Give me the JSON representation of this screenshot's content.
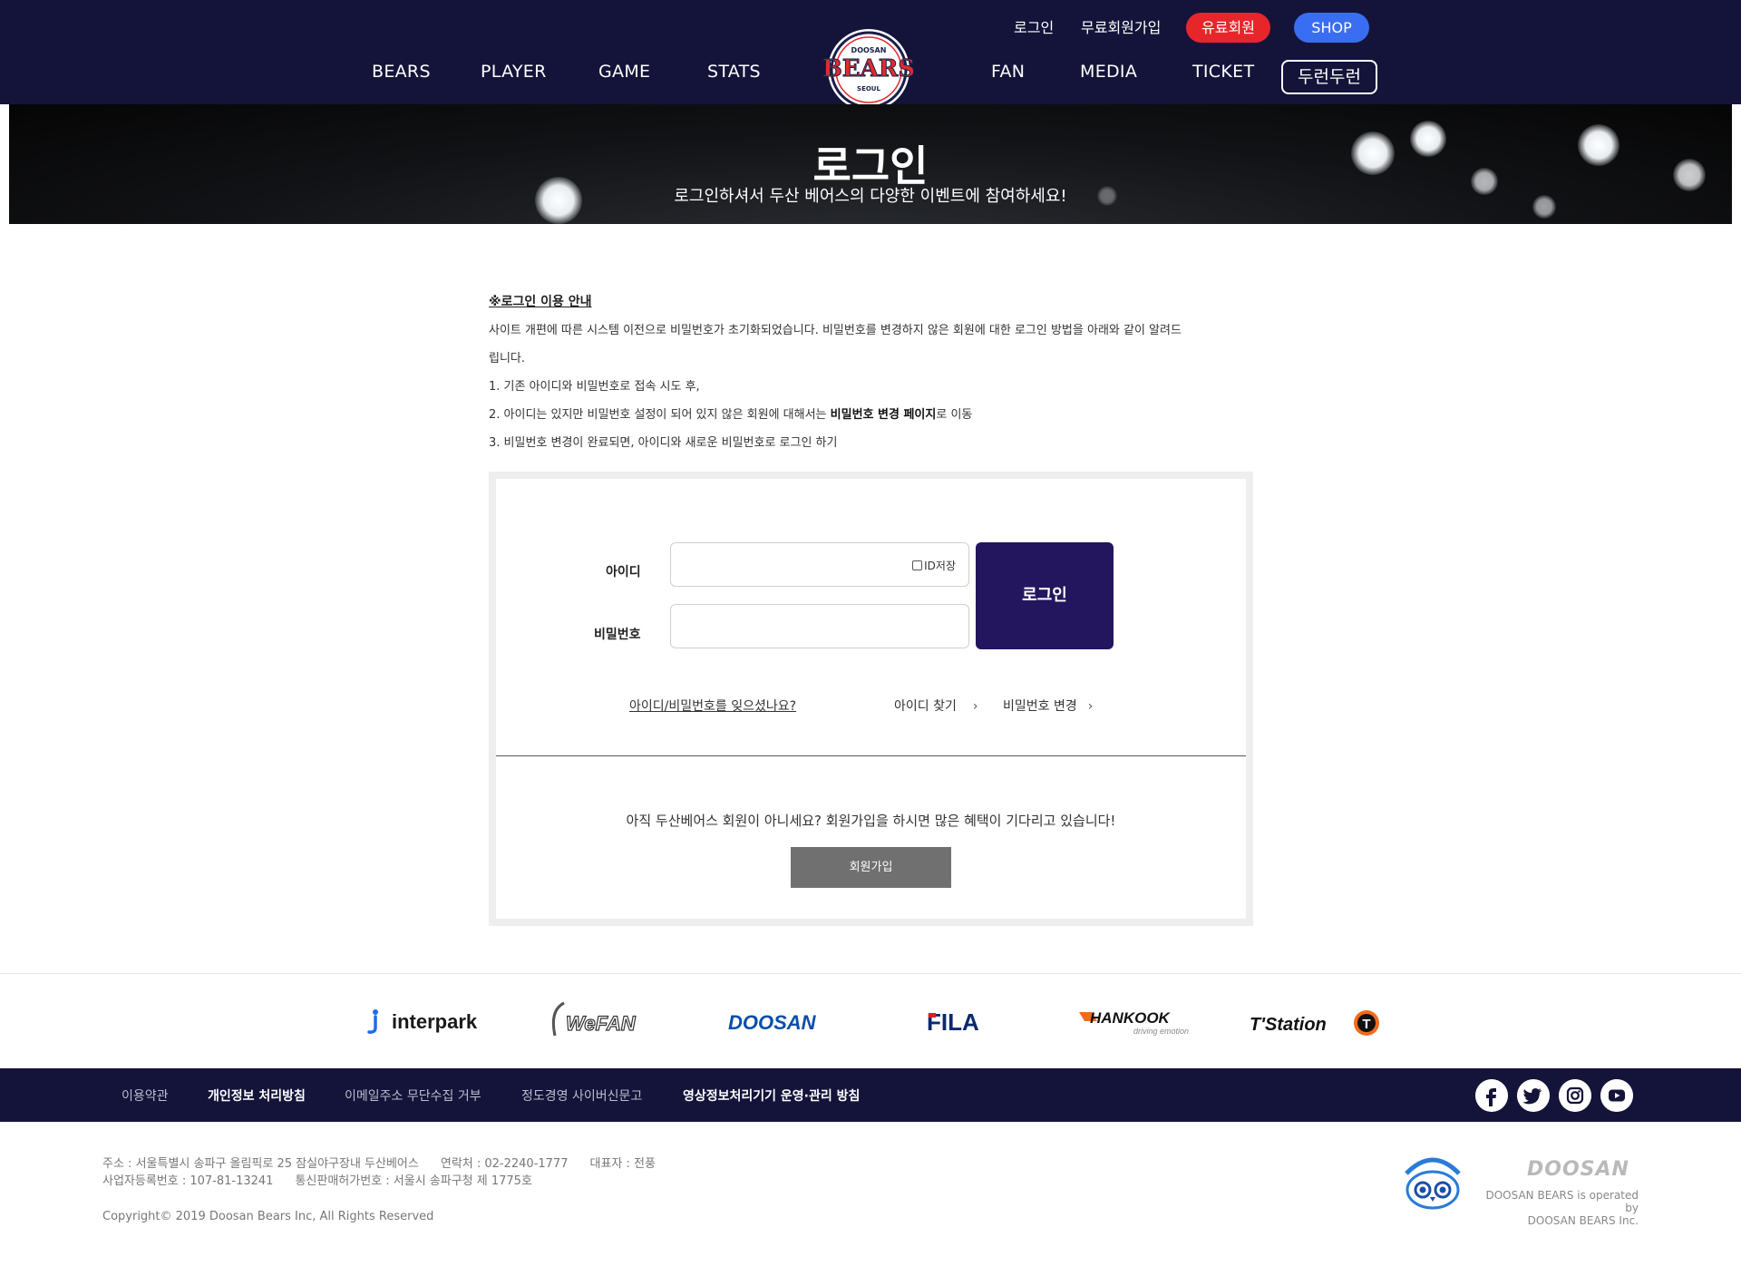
{
  "header": {
    "util": {
      "login": "로그인",
      "join": "무료회원가입",
      "paid": "유료회원",
      "shop": "SHOP"
    },
    "nav": [
      "BEARS",
      "PLAYER",
      "GAME",
      "STATS",
      "FAN",
      "MEDIA",
      "TICKET",
      "두런두런"
    ],
    "logo": {
      "top": "DOOSAN",
      "main": "BEARS",
      "bottom": "SEOUL"
    }
  },
  "hero": {
    "title": "로그인",
    "subtitle": "로그인하셔서 두산 베어스의 다양한 이벤트에 참여하세요!"
  },
  "notice": {
    "title": "※로그인 이용 안내",
    "line1": "사이트 개편에 따른 시스템 이전으로 비밀번호가 초기화되었습니다. 비밀번호를 변경하지 않은 회원에 대한 로그인 방법을 아래와 같이 알려드",
    "line2": "립니다.",
    "line3": "1. 기존 아이디와 비밀번호로 접속 시도 후,",
    "line4_pre": "2. 아이디는 있지만 비밀번호 설정이 되어 있지 않은 회원에 대해서는 ",
    "line4_bold": "비밀번호 변경 페이지",
    "line4_post": "로 이동",
    "line5": "3. 비밀번호 변경이 완료되면, 아이디와 새로운 비밀번호로 로그인 하기"
  },
  "login": {
    "id_label": "아이디",
    "pw_label": "비밀번호",
    "id_save": "ID저장",
    "button": "로그인",
    "forgot": "아이디/비밀번호를 잊으셨나요?",
    "find_id": "아이디 찾기",
    "change_pw": "비밀번호 변경",
    "chevron": "›",
    "join_msg": "아직 두산베어스 회원이 아니세요? 회원가입을 하시면 많은 혜택이 기다리고 있습니다!",
    "join_button": "회원가입"
  },
  "sponsors": {
    "interpark": "interpark",
    "wefan": "WeFAN",
    "doosan": "DOOSAN",
    "fila": "FILA",
    "hankook": "HANKOOK",
    "hankook_sub": "driving emotion",
    "tstation": "T'Station",
    "tstation_badge": "T"
  },
  "footer_nav": [
    "이용약관",
    "개인정보 처리방침",
    "이메일주소 무단수집 거부",
    "정도경영 사이버신문고",
    "영상정보처리기기 운영·관리 방침"
  ],
  "footer": {
    "address": "주소 : 서울특별시 송파구 올림픽로 25 잠실야구장내 두산베어스",
    "contact": "연락처 : 02-2240-1777",
    "ceo": "대표자 : 전풍",
    "biz": "사업자등록번호 : 107-81-13241",
    "telecom": "통신판매허가번호 : 서울시 송파구청 제 1775호",
    "copyright": "Copyright© 2019 Doosan Bears Inc, All Rights Reserved",
    "brand": "DOOSAN",
    "operated1": "DOOSAN BEARS is operated by",
    "operated2": "DOOSAN BEARS Inc."
  }
}
